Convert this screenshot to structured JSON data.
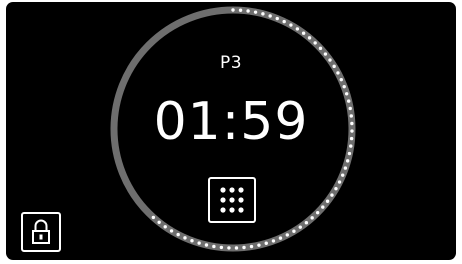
{
  "display": {
    "program": "P3",
    "time": "01:59"
  },
  "icons": {
    "keypad": "keypad-icon",
    "lock": "padlock-icon"
  },
  "colors": {
    "background": "#000000",
    "foreground": "#ffffff",
    "ring_track": "#6e6e6e",
    "ring_progress": "#ffffff"
  }
}
